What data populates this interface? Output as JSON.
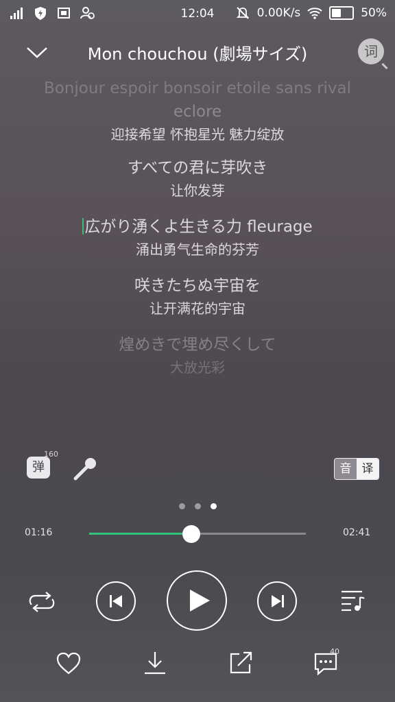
{
  "status_bar": {
    "time": "12:04",
    "network_speed": "0.00K/s",
    "battery_percent": "50%",
    "battery_level": 0.5,
    "icons": [
      "signal-icon",
      "shield-icon",
      "screenshot-icon",
      "user-icon",
      "mute-icon",
      "wifi-icon",
      "battery-icon"
    ]
  },
  "header": {
    "title": "Mon chouchou (劇場サイズ)",
    "lyrics_button": "词"
  },
  "lyrics": [
    {
      "text": "Bonjour espoir bonsoir etoile sans rival",
      "style": "faded"
    },
    {
      "text": "eclore",
      "style": "faded2"
    },
    {
      "text": "迎接希望 怀抱星光 魅力绽放",
      "style": "translation"
    },
    {
      "text": "すべての君に芽吹き",
      "style": "line"
    },
    {
      "text": "让你发芽",
      "style": "translation"
    },
    {
      "text": "広がり湧くよ生きる力 fleurage",
      "style": "current"
    },
    {
      "text": "涌出勇气生命的芬芳",
      "style": "translation"
    },
    {
      "text": "咲きたちぬ宇宙を",
      "style": "line"
    },
    {
      "text": "让开满花的宇宙",
      "style": "translation"
    },
    {
      "text": "煌めきで埋め尽くして",
      "style": "faded2"
    },
    {
      "text": "大放光彩",
      "style": "faded"
    }
  ],
  "tools": {
    "danmaku_label": "弹",
    "danmaku_count": "160",
    "yin_label": "音",
    "yi_label": "译"
  },
  "pager": {
    "count": 3,
    "active": 2
  },
  "progress": {
    "current_time": "01:16",
    "total_time": "02:41",
    "fraction": 0.472
  },
  "bottom_actions": {
    "comment_count": "40"
  },
  "colors": {
    "accent": "#31c27c"
  }
}
